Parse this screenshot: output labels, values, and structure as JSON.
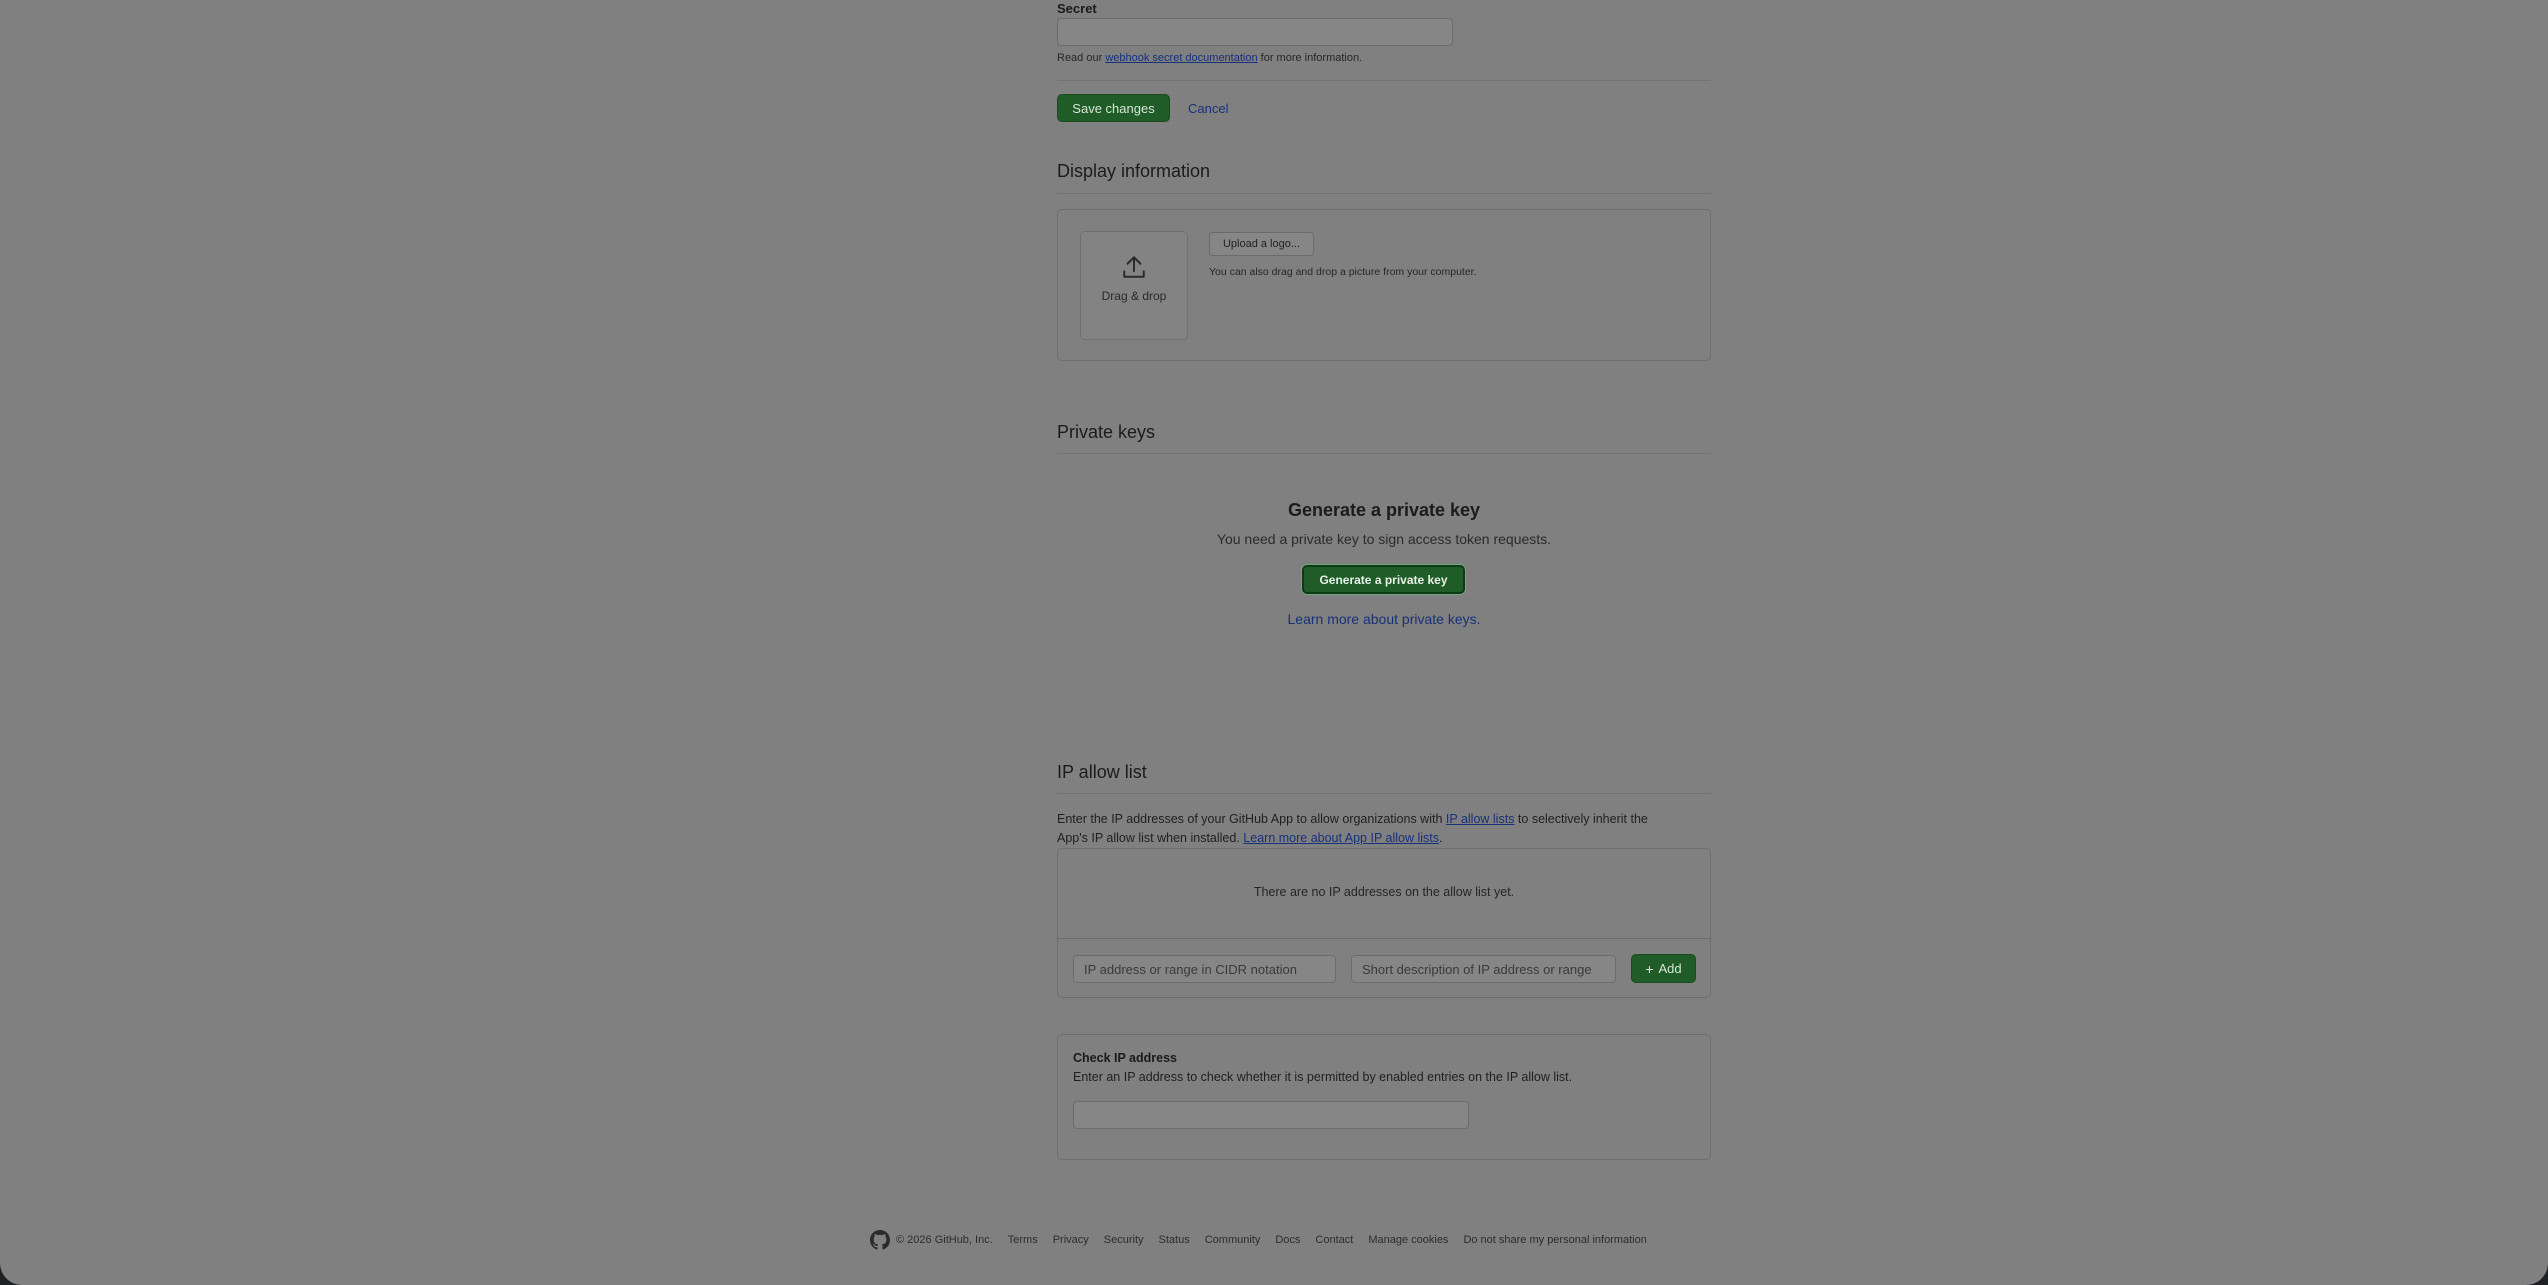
{
  "webhook": {
    "secret_label": "Secret",
    "secret_value": "",
    "help_prefix": "Read our",
    "help_link": "webhook secret documentation",
    "help_suffix": "for more information.",
    "save_label": "Save changes",
    "cancel_label": "Cancel"
  },
  "display_information": {
    "title": "Display information",
    "dropzone_label": "Drag & drop",
    "upload_label": "Upload a logo...",
    "upload_help": "You can also drag and drop a picture from your computer."
  },
  "private_keys": {
    "title": "Private keys",
    "heading": "Generate a private key",
    "description": "You need a private key to sign access token requests.",
    "generate_label": "Generate a private key",
    "learn_more": "Learn more about private keys."
  },
  "ip_allow_list": {
    "title": "IP allow list",
    "desc_part1": "Enter the IP addresses of your GitHub App to allow organizations with",
    "desc_link1": "IP allow lists",
    "desc_part2": "to selectively inherit the",
    "desc_part3": "App's IP allow list when installed.",
    "desc_link2": "Learn more about App IP allow lists",
    "desc_end": ".",
    "empty_message": "There are no IP addresses on the allow list yet.",
    "ip_placeholder": "IP address or range in CIDR notation",
    "desc_placeholder": "Short description of IP address or range",
    "add_label": "Add"
  },
  "check_ip": {
    "title": "Check IP address",
    "description": "Enter an IP address to check whether it is permitted by enabled entries on the IP allow list.",
    "value": ""
  },
  "footer": {
    "copyright": "© 2026 GitHub, Inc.",
    "links": [
      "Terms",
      "Privacy",
      "Security",
      "Status",
      "Community",
      "Docs",
      "Contact",
      "Manage cookies",
      "Do not share my personal information"
    ]
  },
  "colors": {
    "overlay_gray": "#808080",
    "button_green": "#1f5c27",
    "link_blue": "#17307a"
  }
}
